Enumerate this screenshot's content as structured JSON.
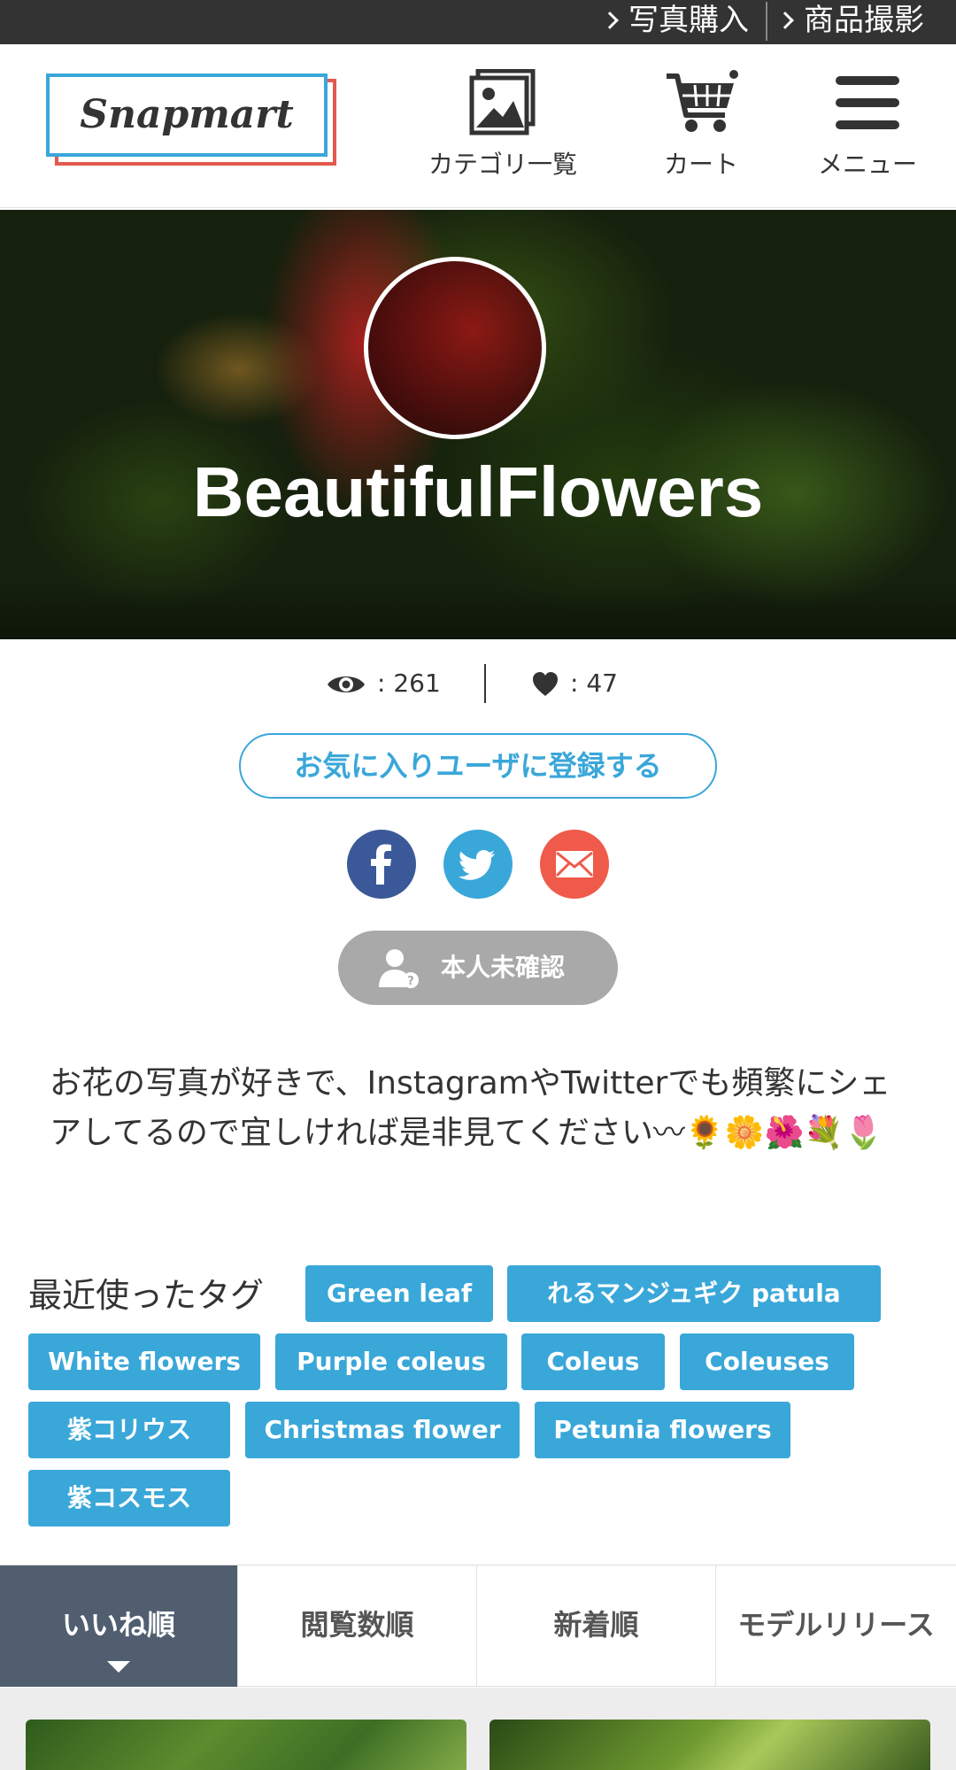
{
  "topbar": {
    "link1": "写真購入",
    "link2": "商品撮影"
  },
  "header": {
    "logo_text": "Snapmart",
    "nav": {
      "categories": "カテゴリ一覧",
      "cart": "カート",
      "menu": "メニュー"
    }
  },
  "profile": {
    "username": "BeautifulFlowers",
    "views": ": 261",
    "likes": ": 47",
    "favorite_button": "お気に入りユーザに登録する",
    "verify_badge": "本人未確認",
    "bio": "お花の写真が好きで、InstagramやTwitterでも頻繁にシェアしてるので宜しければ是非見てください〰🌻🌼🌺💐🌷"
  },
  "tags": {
    "label": "最近使ったタグ",
    "items": [
      "Green leaf",
      "れるマンジュギク patula",
      "White flowers",
      "Purple coleus",
      "Coleus",
      "Coleuses",
      "紫コリウス",
      "Christmas flower",
      "Petunia flowers",
      "紫コスモス"
    ]
  },
  "sort_tabs": {
    "items": [
      "いいね順",
      "閲覧数順",
      "新着順",
      "モデルリリース"
    ],
    "active_index": 0
  },
  "colors": {
    "accent": "#3aa7d9",
    "logo_red": "#e2594e",
    "tab_active": "#505e70",
    "badge_gray": "#a9a9a9"
  },
  "icons": {
    "share": [
      "facebook-icon",
      "twitter-icon",
      "mail-icon"
    ]
  }
}
